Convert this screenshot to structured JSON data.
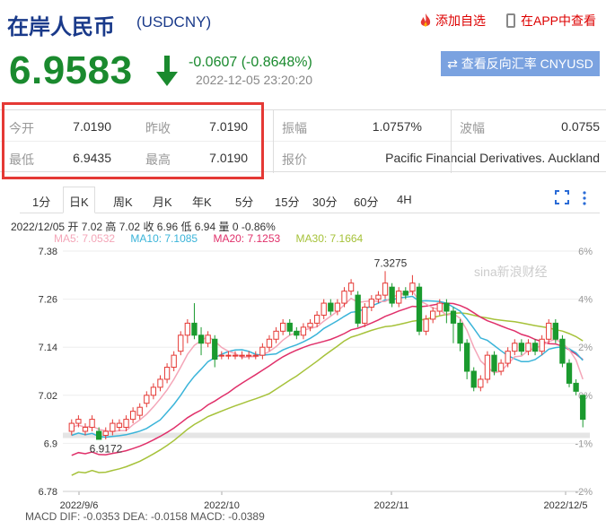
{
  "header": {
    "name": "在岸人民币",
    "code": "(USDCNY)",
    "add_fav": "添加自选",
    "app_view": "在APP中查看"
  },
  "quote": {
    "price": "6.9583",
    "change": "-0.0607 (-0.8648%)",
    "timestamp": "2022-12-05 23:20:20",
    "reverse_button": "⇄ 查看反向汇率 CNYUSD"
  },
  "stats": {
    "open_label": "今开",
    "open_value": "7.0190",
    "prev_close_label": "昨收",
    "prev_close_value": "7.0190",
    "amplitude_label": "振幅",
    "amplitude_value": "1.0757%",
    "wave_label": "波幅",
    "wave_value": "0.0755",
    "low_label": "最低",
    "low_value": "6.9435",
    "high_label": "最高",
    "high_value": "7.0190",
    "quote_label": "报价",
    "quote_value": "Pacific Financial Derivatives. Auckland"
  },
  "tabs": [
    "1分",
    "日K",
    "周K",
    "月K",
    "年K",
    "5分",
    "15分",
    "30分",
    "60分",
    "4H"
  ],
  "active_tab": "日K",
  "chart_info": {
    "ohlc_line": "2022/12/05 开 7.02 高 7.02 收 6.96 低 6.94 量 0 -0.86%",
    "ma5": "MA5: 7.0532",
    "ma10": "MA10: 7.1085",
    "ma20": "MA20: 7.1253",
    "ma30": "MA30: 7.1664",
    "macd_line": "MACD   DIF: -0.0353        DEA: -0.0158        MACD: -0.0389",
    "watermark": "sina新浪财经"
  },
  "colors": {
    "up": "#e53935",
    "down": "#1a9a2e",
    "ma5": "#f4a6b8",
    "ma10": "#3ab4d9",
    "ma20": "#e0306a",
    "ma30": "#a6c23a"
  },
  "chart_data": {
    "type": "candlestick",
    "y_ticks": [
      "7.38",
      "7.26",
      "7.14",
      "7.02",
      "6.9",
      "6.78"
    ],
    "pct_ticks": [
      "6%",
      "4%",
      "2%",
      "0%",
      "-1%",
      "-2%"
    ],
    "x_ticks": [
      "2022/9/6",
      "2022/10",
      "2022/11",
      "2022/12/5"
    ],
    "ylim": [
      6.78,
      7.38
    ],
    "annotations": [
      {
        "label": "7.3275",
        "value": 7.3275
      },
      {
        "label": "6.9172",
        "value": 6.9172
      }
    ],
    "candles": [
      [
        6.93,
        6.95,
        6.92,
        6.96
      ],
      [
        6.95,
        6.96,
        6.94,
        6.97
      ],
      [
        6.93,
        6.94,
        6.92,
        6.95
      ],
      [
        6.94,
        6.96,
        6.93,
        6.97
      ],
      [
        6.93,
        6.91,
        6.91,
        6.94
      ],
      [
        6.92,
        6.93,
        6.91,
        6.94
      ],
      [
        6.93,
        6.95,
        6.92,
        6.96
      ],
      [
        6.94,
        6.95,
        6.93,
        6.96
      ],
      [
        6.94,
        6.96,
        6.93,
        6.97
      ],
      [
        6.96,
        6.98,
        6.95,
        6.99
      ],
      [
        6.97,
        6.99,
        6.96,
        7.0
      ],
      [
        7.0,
        7.02,
        6.99,
        7.03
      ],
      [
        7.02,
        7.04,
        7.01,
        7.05
      ],
      [
        7.04,
        7.06,
        7.03,
        7.07
      ],
      [
        7.06,
        7.09,
        7.05,
        7.1
      ],
      [
        7.09,
        7.12,
        7.08,
        7.13
      ],
      [
        7.13,
        7.17,
        7.12,
        7.18
      ],
      [
        7.17,
        7.2,
        7.15,
        7.21
      ],
      [
        7.2,
        7.17,
        7.16,
        7.25
      ],
      [
        7.17,
        7.15,
        7.12,
        7.19
      ],
      [
        7.15,
        7.17,
        7.14,
        7.18
      ],
      [
        7.16,
        7.11,
        7.09,
        7.17
      ],
      [
        7.12,
        7.12,
        7.11,
        7.13
      ],
      [
        7.12,
        7.12,
        7.11,
        7.13
      ],
      [
        7.12,
        7.12,
        7.11,
        7.13
      ],
      [
        7.12,
        7.12,
        7.11,
        7.13
      ],
      [
        7.12,
        7.12,
        7.11,
        7.13
      ],
      [
        7.12,
        7.12,
        7.11,
        7.13
      ],
      [
        7.12,
        7.14,
        7.11,
        7.15
      ],
      [
        7.14,
        7.16,
        7.13,
        7.17
      ],
      [
        7.16,
        7.18,
        7.15,
        7.19
      ],
      [
        7.18,
        7.2,
        7.17,
        7.21
      ],
      [
        7.2,
        7.18,
        7.17,
        7.21
      ],
      [
        7.18,
        7.17,
        7.16,
        7.19
      ],
      [
        7.17,
        7.19,
        7.16,
        7.2
      ],
      [
        7.19,
        7.2,
        7.18,
        7.21
      ],
      [
        7.2,
        7.22,
        7.19,
        7.23
      ],
      [
        7.22,
        7.25,
        7.21,
        7.26
      ],
      [
        7.25,
        7.23,
        7.22,
        7.26
      ],
      [
        7.23,
        7.25,
        7.22,
        7.26
      ],
      [
        7.25,
        7.28,
        7.24,
        7.29
      ],
      [
        7.28,
        7.3,
        7.27,
        7.31
      ],
      [
        7.27,
        7.2,
        7.19,
        7.28
      ],
      [
        7.2,
        7.24,
        7.19,
        7.25
      ],
      [
        7.24,
        7.26,
        7.23,
        7.27
      ],
      [
        7.26,
        7.27,
        7.25,
        7.28
      ],
      [
        7.27,
        7.3,
        7.26,
        7.33
      ],
      [
        7.29,
        7.25,
        7.24,
        7.3
      ],
      [
        7.25,
        7.28,
        7.24,
        7.29
      ],
      [
        7.28,
        7.27,
        7.26,
        7.29
      ],
      [
        7.28,
        7.3,
        7.27,
        7.32
      ],
      [
        7.29,
        7.18,
        7.17,
        7.3
      ],
      [
        7.18,
        7.21,
        7.17,
        7.22
      ],
      [
        7.21,
        7.23,
        7.2,
        7.24
      ],
      [
        7.23,
        7.25,
        7.22,
        7.26
      ],
      [
        7.25,
        7.23,
        7.2,
        7.26
      ],
      [
        7.23,
        7.2,
        7.15,
        7.24
      ],
      [
        7.2,
        7.15,
        7.13,
        7.21
      ],
      [
        7.15,
        7.08,
        7.06,
        7.16
      ],
      [
        7.08,
        7.04,
        7.03,
        7.09
      ],
      [
        7.04,
        7.06,
        7.03,
        7.07
      ],
      [
        7.06,
        7.12,
        7.05,
        7.13
      ],
      [
        7.12,
        7.08,
        7.07,
        7.13
      ],
      [
        7.08,
        7.1,
        7.07,
        7.11
      ],
      [
        7.1,
        7.13,
        7.09,
        7.14
      ],
      [
        7.13,
        7.15,
        7.12,
        7.16
      ],
      [
        7.15,
        7.13,
        7.12,
        7.16
      ],
      [
        7.13,
        7.15,
        7.12,
        7.16
      ],
      [
        7.15,
        7.13,
        7.12,
        7.16
      ],
      [
        7.13,
        7.16,
        7.12,
        7.17
      ],
      [
        7.16,
        7.2,
        7.15,
        7.21
      ],
      [
        7.2,
        7.16,
        7.15,
        7.21
      ],
      [
        7.16,
        7.1,
        7.09,
        7.17
      ],
      [
        7.1,
        7.05,
        7.04,
        7.11
      ],
      [
        7.05,
        7.03,
        7.02,
        7.06
      ],
      [
        7.02,
        6.96,
        6.94,
        7.02
      ]
    ]
  }
}
